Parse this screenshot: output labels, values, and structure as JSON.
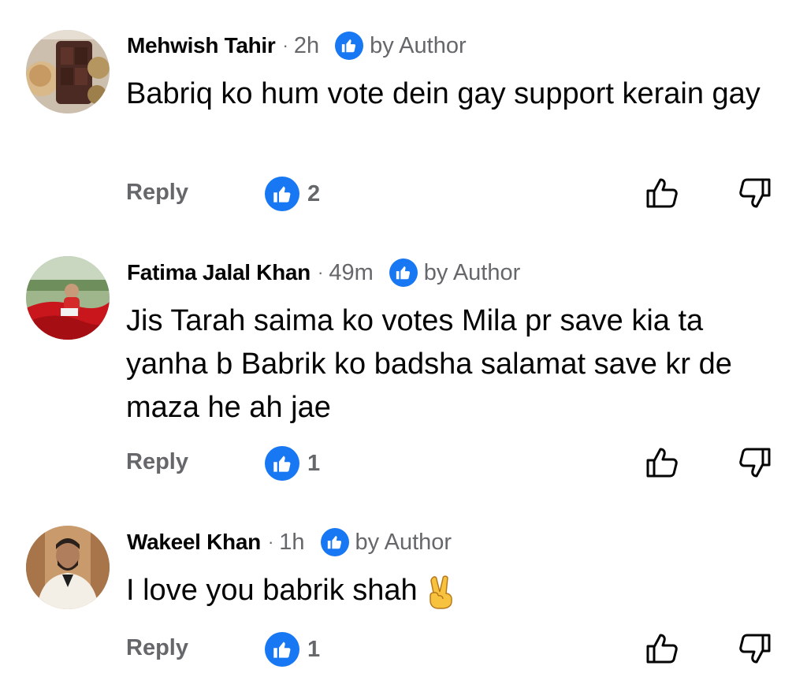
{
  "comments": [
    {
      "author": "Mehwish Tahir",
      "time": "2h",
      "author_badge": "by Author",
      "text": "Babriq ko hum vote dein gay support kerain gay",
      "reply_label": "Reply",
      "like_count": "2"
    },
    {
      "author": "Fatima Jalal Khan",
      "time": "49m",
      "author_badge": "by Author",
      "text": "Jis Tarah saima ko votes Mila pr save kia ta yanha b Babrik ko badsha salamat save kr de maza he ah jae",
      "reply_label": "Reply",
      "like_count": "1"
    },
    {
      "author": "Wakeel Khan",
      "time": "1h",
      "author_badge": "by Author",
      "text": "I love you babrik shah",
      "emoji": "victory-hand",
      "reply_label": "Reply",
      "like_count": "1"
    }
  ],
  "dot_separator": "·",
  "colors": {
    "accent_blue": "#1877f2",
    "secondary_text": "#65676b",
    "primary_text": "#050505"
  },
  "icons": {
    "author_badge": "thumbs-up-badge-icon",
    "reaction": "like-reaction-icon",
    "upvote": "thumbs-up-outline-icon",
    "downvote": "thumbs-down-outline-icon"
  }
}
